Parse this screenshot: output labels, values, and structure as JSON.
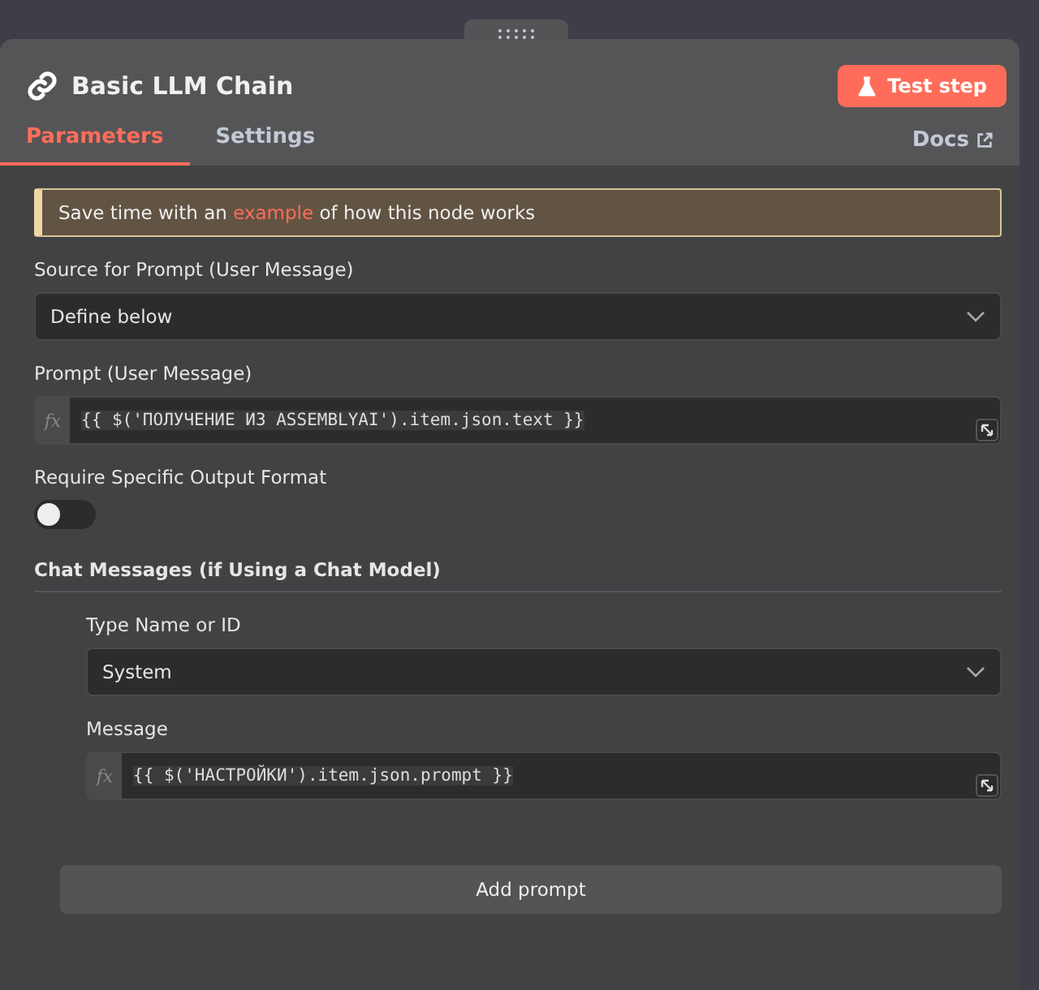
{
  "title": "Basic LLM Chain",
  "test_button": "Test step",
  "tabs": [
    {
      "label": "Parameters",
      "selected": true
    },
    {
      "label": "Settings",
      "selected": false
    }
  ],
  "docs_link": "Docs",
  "notice": {
    "before": "Save time with an ",
    "link": "example",
    "after": " of how this node works"
  },
  "fields": [
    {
      "kind": "select",
      "label": "Source for Prompt (User Message)",
      "value": "Define below"
    },
    {
      "kind": "expression",
      "label": "Prompt (User Message)",
      "fx": "fx",
      "value": "{{ $('ПОЛУЧЕНИЕ ИЗ ASSEMBLYAI').item.json.text }}"
    },
    {
      "kind": "toggle",
      "label": "Require Specific Output Format",
      "on": false
    },
    {
      "kind": "section",
      "label": "Chat Messages (if Using a Chat Model)",
      "children": [
        {
          "kind": "select",
          "label": "Type Name or ID",
          "value": "System"
        },
        {
          "kind": "expression",
          "label": "Message",
          "fx": "fx",
          "value": "{{ $('НАСТРОЙКИ').item.json.prompt }}"
        }
      ],
      "add_button": "Add prompt"
    }
  ]
}
